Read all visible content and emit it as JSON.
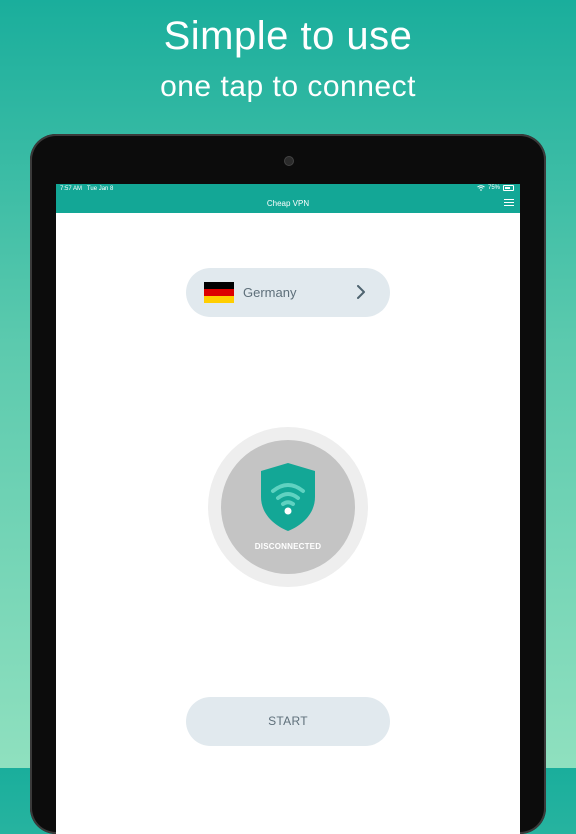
{
  "promo": {
    "title": "Simple to use",
    "subtitle": "one tap to connect"
  },
  "status_bar": {
    "time": "7:57 AM",
    "date": "Tue Jan 8",
    "battery": "75%"
  },
  "app_bar": {
    "title": "Cheap VPN",
    "menu_icon": "hamburger-menu-icon"
  },
  "country_selector": {
    "country": "Germany",
    "flag_colors": [
      "#000000",
      "#dd0000",
      "#ffce00"
    ],
    "chevron_icon": "chevron-right-icon"
  },
  "connection": {
    "status": "DISCONNECTED",
    "icon": "shield-wifi-icon",
    "shield_color": "#13a796"
  },
  "actions": {
    "start_label": "START"
  },
  "colors": {
    "accent": "#13a796",
    "pill_bg": "#e1e9ee",
    "disconnected_gray": "#c4c4c4"
  }
}
